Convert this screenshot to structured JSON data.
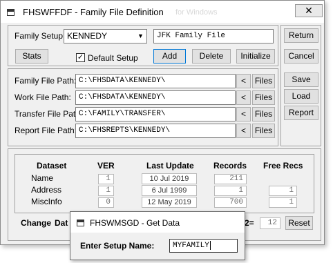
{
  "window": {
    "title": "FHSWFFDF - Family File Definition",
    "title_behind": "for Windows",
    "close_glyph": "✕"
  },
  "setup": {
    "family_setup_label": "Family Setup:",
    "family_setup_value": "KENNEDY",
    "family_desc_value": "JFK Family File",
    "stats_label": "Stats",
    "default_setup_label": "Default Setup",
    "default_setup_checked": "✓",
    "add_label": "Add",
    "delete_label": "Delete",
    "initialize_label": "Initialize"
  },
  "side_buttons": {
    "return_label": "Return",
    "cancel_label": "Cancel",
    "save_label": "Save",
    "load_label": "Load",
    "report_label": "Report"
  },
  "paths": [
    {
      "label": "Family File Path:",
      "value": "C:\\FHSDATA\\KENNEDY\\",
      "back": "<",
      "files": "Files"
    },
    {
      "label": "Work File Path:",
      "value": "C:\\FHSDATA\\KENNEDY\\",
      "back": "<",
      "files": "Files"
    },
    {
      "label": "Transfer File Path:",
      "value": "C:\\FAMILY\\TRANSFER\\",
      "back": "<",
      "files": "Files"
    },
    {
      "label": "Report File Path:",
      "value": "C:\\FHSREPTS\\KENNEDY\\",
      "back": "<",
      "files": "Files"
    }
  ],
  "datasets": {
    "headers": {
      "dataset": "Dataset",
      "ver": "VER",
      "last_update": "Last Update",
      "records": "Records",
      "free_recs": "Free Recs"
    },
    "rows": [
      {
        "name": "Name",
        "ver": "1",
        "last_update": "10 Jul 2019",
        "records": "211",
        "free_recs": ""
      },
      {
        "name": "Address",
        "ver": "1",
        "last_update": "6 Jul 1999",
        "records": "1",
        "free_recs": "1"
      },
      {
        "name": "MiscInfo",
        "ver": "0",
        "last_update": "12 May 2019",
        "records": "700",
        "free_recs": "1"
      }
    ]
  },
  "bottom": {
    "change_label": "Change",
    "data_label": "Dat",
    "field2_label": "2=",
    "field2_value": "12",
    "reset_label": "Reset"
  },
  "dialog": {
    "title": "FHSWMSGD - Get Data",
    "prompt": "Enter Setup Name:",
    "value": "MYFAMILY"
  }
}
